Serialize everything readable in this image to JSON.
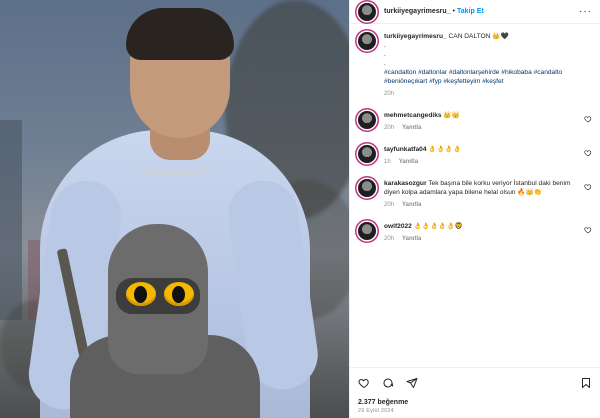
{
  "post": {
    "author": "turkiiyegayrimesru_",
    "follow_label": "Takip Et",
    "separator": "•",
    "more": "···"
  },
  "caption": {
    "author": "turkiiyegayrimesru_",
    "text": "CAN DALTON 👑🖤",
    "lines": [
      ".",
      ".",
      "."
    ],
    "hashtags": "#candalton #daltonlar #daltonlarşehirde #hikobaba #candalto #beniöneçıkart #fyp #keşfetteyim #keşfet",
    "time": "20h"
  },
  "comments": [
    {
      "user": "mehmetcangediks",
      "text": "👑👑",
      "time": "20h",
      "reply": "Yanıtla"
    },
    {
      "user": "tayfunkatfa04",
      "text": "👌👌👌👌",
      "time": "1h",
      "reply": "Yanıtla"
    },
    {
      "user": "karakasozgur",
      "text": "Tek başına bile korku veriyor İstanbul daki benim diyen kolpa adamlara yapa bilene helal olsun 🔥👑👏",
      "time": "20h",
      "reply": "Yanıtla"
    },
    {
      "user": "owlf2022",
      "text": "👌👌👌👌👌🦁",
      "time": "20h",
      "reply": "Yanıtla"
    }
  ],
  "footer": {
    "likes": "2.377 beğenme",
    "date": "29 Eylül 2024"
  },
  "icons": [
    "heart-icon",
    "comment-icon",
    "share-icon",
    "bookmark-icon",
    "more-icon"
  ],
  "colors": {
    "accent": "#0095f6",
    "text": "#262626",
    "muted": "#8e8e8e",
    "ring": "#c13584"
  }
}
